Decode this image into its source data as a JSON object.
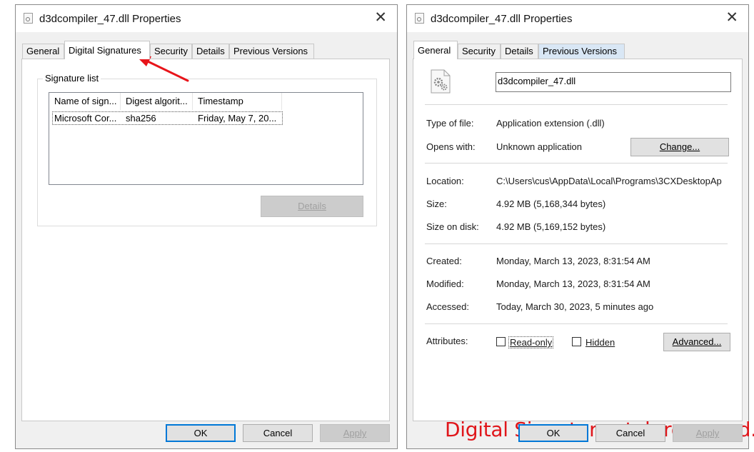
{
  "left_dialog": {
    "title": "d3dcompiler_47.dll Properties",
    "tabs": [
      "General",
      "Digital Signatures",
      "Security",
      "Details",
      "Previous Versions"
    ],
    "active_tab": "Digital Signatures",
    "signature_list": {
      "group_label": "Signature list",
      "columns": [
        "Name of sign...",
        "Digest algorit...",
        "Timestamp"
      ],
      "rows": [
        {
          "name": "Microsoft Cor...",
          "digest": "sha256",
          "timestamp": "Friday, May 7, 20..."
        }
      ]
    },
    "details_button": "Details",
    "buttons": {
      "ok": "OK",
      "cancel": "Cancel",
      "apply": "Apply"
    }
  },
  "right_dialog": {
    "title": "d3dcompiler_47.dll Properties",
    "tabs": [
      "General",
      "Security",
      "Details",
      "Previous Versions"
    ],
    "active_tab": "General",
    "file_name": "d3dcompiler_47.dll",
    "type_label": "Type of file:",
    "type_value": "Application extension (.dll)",
    "opens_label": "Opens with:",
    "opens_value": "Unknown application",
    "change_button": "Change...",
    "location_label": "Location:",
    "location_value": "C:\\Users\\cus\\AppData\\Local\\Programs\\3CXDesktopAp",
    "size_label": "Size:",
    "size_value": "4.92 MB (5,168,344 bytes)",
    "size_disk_label": "Size on disk:",
    "size_disk_value": "4.92 MB (5,169,152 bytes)",
    "created_label": "Created:",
    "created_value": "Monday, March 13, 2023, 8:31:54 AM",
    "modified_label": "Modified:",
    "modified_value": "Monday, March 13, 2023, 8:31:54 AM",
    "accessed_label": "Accessed:",
    "accessed_value": "Today, March 30, 2023, 5 minutes ago",
    "attributes_label": "Attributes:",
    "readonly_label": "Read-only",
    "hidden_label": "Hidden",
    "advanced_button": "Advanced...",
    "note": "Digital Signatures tab removed.",
    "buttons": {
      "ok": "OK",
      "cancel": "Cancel",
      "apply": "Apply"
    }
  },
  "colors": {
    "note_red": "#e0161b",
    "arrow_red": "#e8141a",
    "focus_blue": "#0078d7",
    "hover_tab_blue": "#d9e7f5"
  },
  "icons": {
    "title": "dll-file-icon",
    "close": "close-icon",
    "file": "dll-gear-file-icon",
    "annotation": "red-arrow-icon"
  }
}
